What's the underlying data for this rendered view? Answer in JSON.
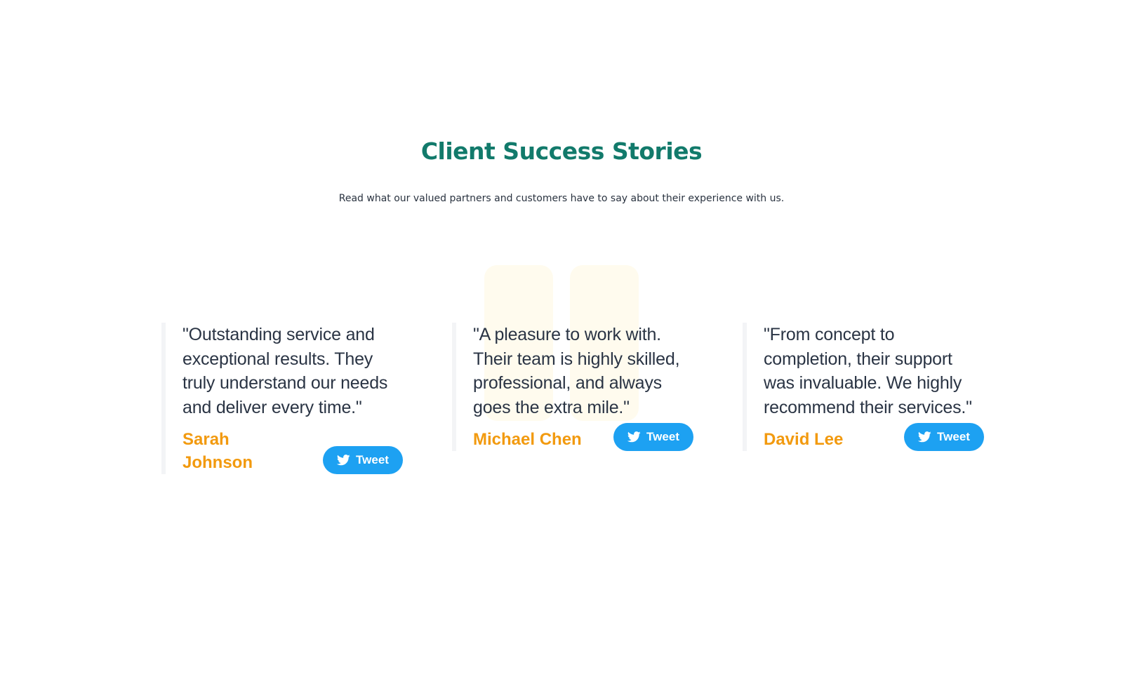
{
  "section": {
    "title": "Client Success Stories",
    "subtitle": "Read what our valued partners and customers have to say about their experience with us."
  },
  "testimonials": [
    {
      "quote": "\"Outstanding service and exceptional results. They truly understand our needs and deliver every time.\"",
      "name": "Sarah Johnson",
      "tweet_label": "Tweet"
    },
    {
      "quote": "\"A pleasure to work with. Their team is highly skilled, professional, and always goes the extra mile.\"",
      "name": "Michael Chen",
      "tweet_label": "Tweet"
    },
    {
      "quote": "\"From concept to completion, their support was invaluable. We highly recommend their services.\"",
      "name": "David Lee",
      "tweet_label": "Tweet"
    }
  ],
  "colors": {
    "title": "#127a6b",
    "name": "#f29a0f",
    "tweet_button": "#1da1f2",
    "quote_mark": "#fffbee"
  },
  "icons": {
    "tweet": "twitter-bird-icon",
    "decoration": "quote-mark-icon"
  }
}
